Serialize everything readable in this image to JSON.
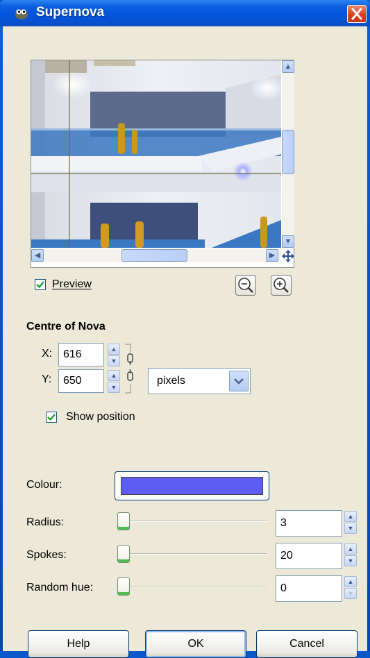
{
  "window": {
    "title": "Supernova"
  },
  "icons": {
    "app": "gimp-wilber-icon",
    "close": "close-icon",
    "zoom_out": "zoom-out-icon",
    "zoom_in": "zoom-in-icon",
    "navigate": "move-navigate-icon",
    "chain": "chain-link-icon"
  },
  "preview": {
    "label": "Preview",
    "checked": true
  },
  "centre": {
    "heading": "Centre of Nova",
    "x_label": "X:",
    "x_value": "616",
    "y_label": "Y:",
    "y_value": "650",
    "unit": "pixels",
    "show_position_label": "Show position",
    "show_position_checked": true
  },
  "params": {
    "colour_label": "Colour:",
    "colour_value": "#5d5df6",
    "radius_label": "Radius:",
    "radius_value": "3",
    "spokes_label": "Spokes:",
    "spokes_value": "20",
    "random_hue_label": "Random hue:",
    "random_hue_value": "0"
  },
  "buttons": {
    "help": "Help",
    "ok": "OK",
    "cancel": "Cancel"
  }
}
